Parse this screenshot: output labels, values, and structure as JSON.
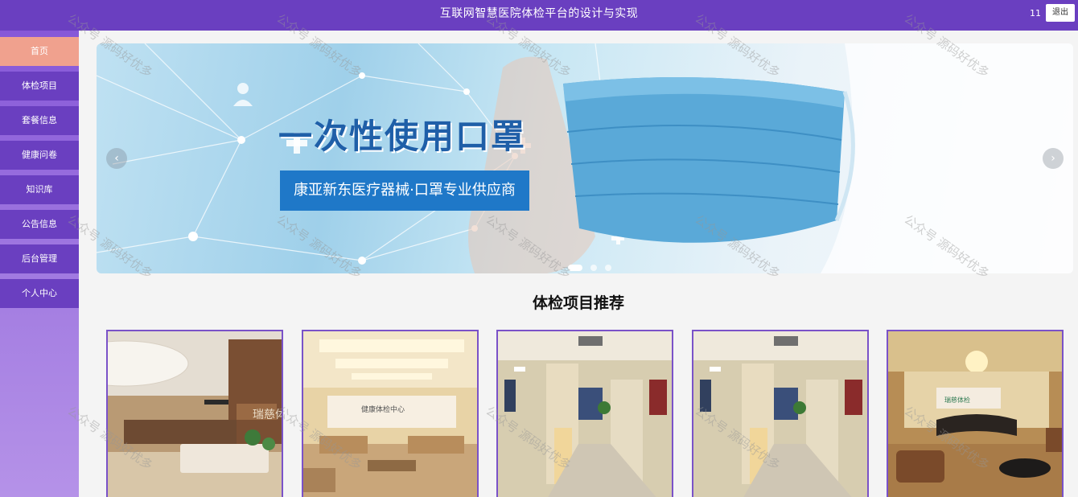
{
  "header": {
    "title": "互联网智慧医院体检平台的设计与实现",
    "user": "11",
    "logout_label": "退出"
  },
  "sidebar": {
    "items": [
      {
        "label": "首页",
        "active": true
      },
      {
        "label": "体检项目"
      },
      {
        "label": "套餐信息"
      },
      {
        "label": "健康问卷"
      },
      {
        "label": "知识库"
      },
      {
        "label": "公告信息"
      },
      {
        "label": "后台管理"
      },
      {
        "label": "个人中心"
      }
    ]
  },
  "banner": {
    "headline": "一次性使用口罩",
    "subtitle": "康亚新东医疗器械·口罩专业供应商",
    "prev_icon": "chevron-left-icon",
    "next_icon": "chevron-right-icon",
    "slide_count": 3,
    "active_slide": 1
  },
  "section": {
    "title": "体检项目推荐"
  },
  "cards": [
    {
      "image": "hospital-lobby-reception"
    },
    {
      "image": "health-center-lounge"
    },
    {
      "image": "hospital-corridor"
    },
    {
      "image": "hospital-corridor"
    },
    {
      "image": "reception-lobby-sofas"
    }
  ],
  "watermark": "公众号 源码好优多",
  "colors": {
    "primary": "#6a3fc0",
    "active_nav": "#f0a18e",
    "banner_box": "#1f78c8",
    "headline": "#1f5fa8"
  }
}
